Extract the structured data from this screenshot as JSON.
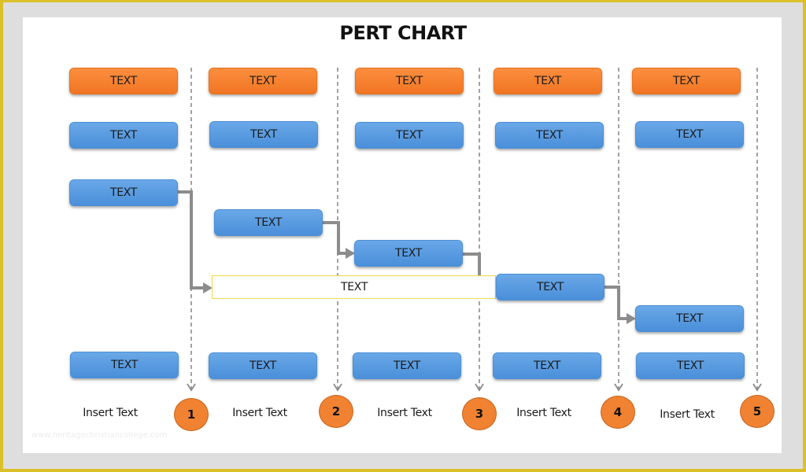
{
  "title": "PERT CHART",
  "colors": {
    "frame": "#dcc02a",
    "border": "#dedede",
    "orange_box": "#f57d2a",
    "blue_box": "#5a9be0",
    "highlight_box_border": "#f3d64a",
    "connector": "#8c8c8c",
    "milestone": "#f08232"
  },
  "rows": {
    "header": [
      "TEXT",
      "TEXT",
      "TEXT",
      "TEXT",
      "TEXT"
    ],
    "row2": [
      "TEXT",
      "TEXT",
      "TEXT",
      "TEXT",
      "TEXT"
    ],
    "bottom": [
      "TEXT",
      "TEXT",
      "TEXT",
      "TEXT",
      "TEXT"
    ]
  },
  "critical_path": {
    "tasks": [
      "TEXT",
      "TEXT",
      "TEXT",
      "TEXT",
      "TEXT"
    ],
    "highlight_label": "TEXT"
  },
  "milestones": [
    {
      "number": "1",
      "label": "Insert Text"
    },
    {
      "number": "2",
      "label": "Insert Text"
    },
    {
      "number": "3",
      "label": "Insert Text"
    },
    {
      "number": "4",
      "label": "Insert Text"
    },
    {
      "number": "5",
      "label": "Insert Text"
    }
  ],
  "watermark": "www.heritagechristiancollege.com"
}
